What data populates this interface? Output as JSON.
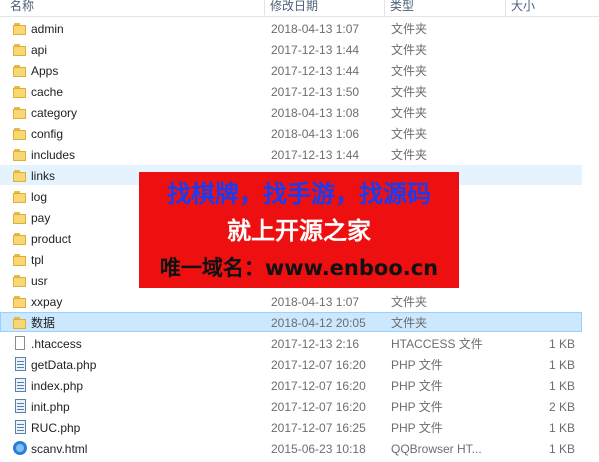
{
  "header": {
    "col_name": "名称",
    "col_modified": "修改日期",
    "col_type": "类型",
    "col_size": "大小"
  },
  "files": [
    {
      "icon": "folder-icon",
      "name": "admin",
      "modified": "2018-04-13 1:07",
      "type": "文件夹",
      "size": ""
    },
    {
      "icon": "folder-icon",
      "name": "api",
      "modified": "2017-12-13 1:44",
      "type": "文件夹",
      "size": ""
    },
    {
      "icon": "folder-icon",
      "name": "Apps",
      "modified": "2017-12-13 1:44",
      "type": "文件夹",
      "size": ""
    },
    {
      "icon": "folder-icon",
      "name": "cache",
      "modified": "2017-12-13 1:50",
      "type": "文件夹",
      "size": ""
    },
    {
      "icon": "folder-icon",
      "name": "category",
      "modified": "2018-04-13 1:08",
      "type": "文件夹",
      "size": ""
    },
    {
      "icon": "folder-icon",
      "name": "config",
      "modified": "2018-04-13 1:06",
      "type": "文件夹",
      "size": ""
    },
    {
      "icon": "folder-icon",
      "name": "includes",
      "modified": "2017-12-13 1:44",
      "type": "文件夹",
      "size": ""
    },
    {
      "icon": "folder-icon",
      "name": "links",
      "modified": "",
      "type": "",
      "size": ""
    },
    {
      "icon": "folder-icon",
      "name": "log",
      "modified": "",
      "type": "",
      "size": ""
    },
    {
      "icon": "folder-icon",
      "name": "pay",
      "modified": "",
      "type": "",
      "size": ""
    },
    {
      "icon": "folder-icon",
      "name": "product",
      "modified": "",
      "type": "",
      "size": ""
    },
    {
      "icon": "folder-icon",
      "name": "tpl",
      "modified": "",
      "type": "",
      "size": ""
    },
    {
      "icon": "folder-icon",
      "name": "usr",
      "modified": "",
      "type": "",
      "size": ""
    },
    {
      "icon": "folder-icon",
      "name": "xxpay",
      "modified": "2018-04-13 1:07",
      "type": "文件夹",
      "size": ""
    },
    {
      "icon": "folder-icon",
      "name": "数据",
      "modified": "2018-04-12 20:05",
      "type": "文件夹",
      "size": ""
    },
    {
      "icon": "file-icon",
      "name": ".htaccess",
      "modified": "2017-12-13 2:16",
      "type": "HTACCESS 文件",
      "size": "1 KB"
    },
    {
      "icon": "php-file-icon",
      "name": "getData.php",
      "modified": "2017-12-07 16:20",
      "type": "PHP 文件",
      "size": "1 KB"
    },
    {
      "icon": "php-file-icon",
      "name": "index.php",
      "modified": "2017-12-07 16:20",
      "type": "PHP 文件",
      "size": "1 KB"
    },
    {
      "icon": "php-file-icon",
      "name": "init.php",
      "modified": "2017-12-07 16:20",
      "type": "PHP 文件",
      "size": "2 KB"
    },
    {
      "icon": "php-file-icon",
      "name": "RUC.php",
      "modified": "2017-12-07 16:25",
      "type": "PHP 文件",
      "size": "1 KB"
    },
    {
      "icon": "html-file-icon",
      "name": "scanv.html",
      "modified": "2015-06-23 10:18",
      "type": "QQBrowser HT...",
      "size": "1 KB"
    }
  ],
  "banner": {
    "line1": "找棋牌，找手游，找源码",
    "line2": "就上开源之家",
    "line3": "唯一域名：www.enboo.cn"
  },
  "colors": {
    "selected_row": "#cce8ff",
    "hover_row": "#e5f3ff",
    "banner_bg": "#ee1010",
    "banner_line1": "#1a3cf0"
  }
}
